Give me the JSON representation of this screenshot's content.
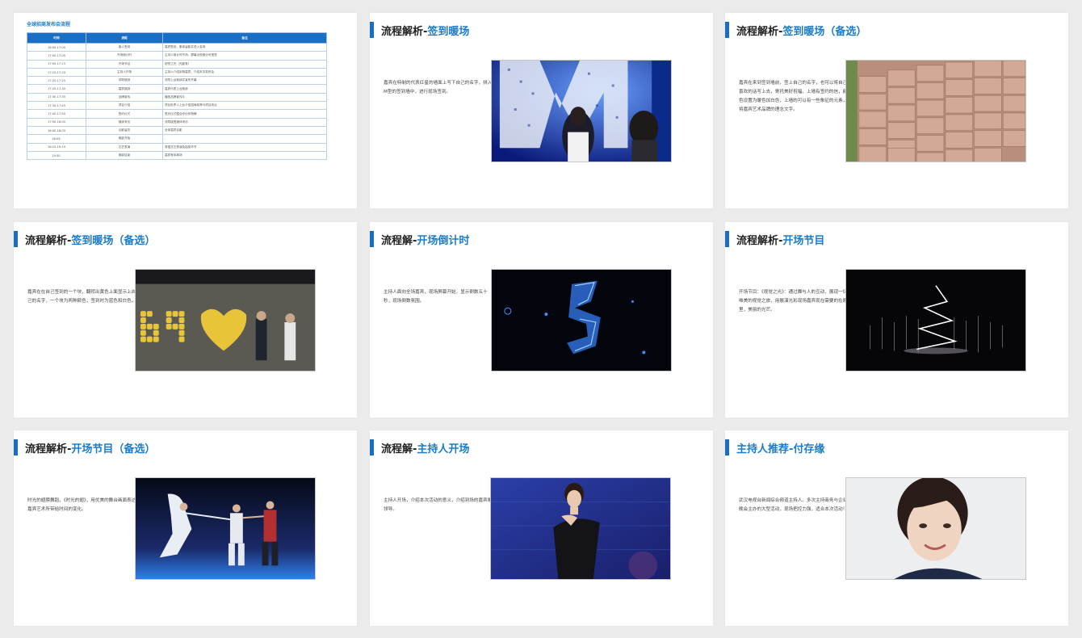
{
  "schedule_slide": {
    "title": "全球招商发布会流程",
    "headers": [
      "时间",
      "流程",
      "备注"
    ],
    "rows": [
      [
        "16:00-17:00",
        "客人签到",
        "嘉宾签到，集体留影并进入会场"
      ],
      [
        "17:00-17:05",
        "开场倒计时",
        "主持人倒计时开场，屏幕出现倒计时视觉"
      ],
      [
        "17:05-17:15",
        "开场节目",
        "视觉之光（光影秀）"
      ],
      [
        "17:15-17:20",
        "主持人开场",
        "主持人介绍到场嘉宾，介绍本次发布会"
      ],
      [
        "17:20-17:25",
        "领导致辞",
        "领导上台致辞并宣布开幕"
      ],
      [
        "17:25-17:30",
        "嘉宾致辞",
        "嘉宾代表上台致辞"
      ],
      [
        "17:30-17:35",
        "品牌宣传",
        "播放品牌宣传片"
      ],
      [
        "17:35-17:45",
        "项目介绍",
        "项目负责人上台介绍招商政策与项目亮点"
      ],
      [
        "17:45-17:50",
        "签约仪式",
        "签约仪式暨合作伙伴授牌"
      ],
      [
        "17:50-18:00",
        "媒体采访",
        "领导接受媒体采访"
      ],
      [
        "18:00-18:05",
        "合影留念",
        "全体嘉宾合影"
      ],
      [
        "18:05-",
        "晚宴开始",
        "-"
      ],
      [
        "18:10-19:10",
        "文艺表演",
        "穿插文艺表演及抽奖环节"
      ],
      [
        "19:30-",
        "晚宴结束",
        "嘉宾有序离场"
      ]
    ]
  },
  "slides": [
    {
      "title_black": "流程解析-",
      "title_blue": "签到暖场",
      "desc": "嘉宾在特制的代表红星的墙面上写下自己的名字，拼入M型的签到墙中，进行现场签到。",
      "image": "signature-wall-photo"
    },
    {
      "title_black": "流程解析-",
      "title_blue": "签到暖场（备选）",
      "desc": "嘉宾在来到签到墙前，签上自己的名字，也可以将自己喜欢的话写上去，寄托美好祝福，上墙有签约的信，颜色设置为暖色加白色，上墙的可以有一些象征的元素，将嘉宾艺术品牌的理念文字。",
      "image": "brick-wall-photo"
    },
    {
      "title_black": "流程解析-",
      "title_blue": "签到暖场（备选）",
      "desc": "嘉宾在在自己签到的一个块，翻转出黄色上面显示上自己的名字，一个块为两种颜色，签到时为蓝色和白色。",
      "image": "light-board-photo"
    },
    {
      "title_black": "流程解-",
      "title_blue": "开场倒计时",
      "desc": "主持人面向全场嘉宾，现场屏幕开始，显示倒数五十秒，现场倒数氛围。",
      "image": "countdown-photo"
    },
    {
      "title_black": "流程解析-",
      "title_blue": "开场节目",
      "desc": "开场节目：《视觉之光》：通过舞与人的互动，展现一切唯美的视觉之旅，用展演光彩现场嘉宾现在需要的在眼里，美丽的光芒。",
      "image": "light-show-photo"
    },
    {
      "title_black": "流程解析-",
      "title_blue": "开场节目（备选）",
      "desc": "时光的翅膀舞蹈，《时光的翅》，用优美的舞台画面表达嘉宾艺术所带给时间的变化。",
      "image": "dance-photo"
    },
    {
      "title_black": "流程解-",
      "title_blue": "主持人开场",
      "desc": "主持人开场，介绍本次活动的意义，介绍到场的嘉宾和领导。",
      "image": "host-photo"
    },
    {
      "title_black": "",
      "title_blue": "主持人推荐-付存缘",
      "desc": "武汉电视台新闻综合频道主持人。多次主持商务与企业晚会主办的大型活动，现场把控力强，适合本次活动！",
      "image": "presenter-portrait-photo"
    }
  ]
}
